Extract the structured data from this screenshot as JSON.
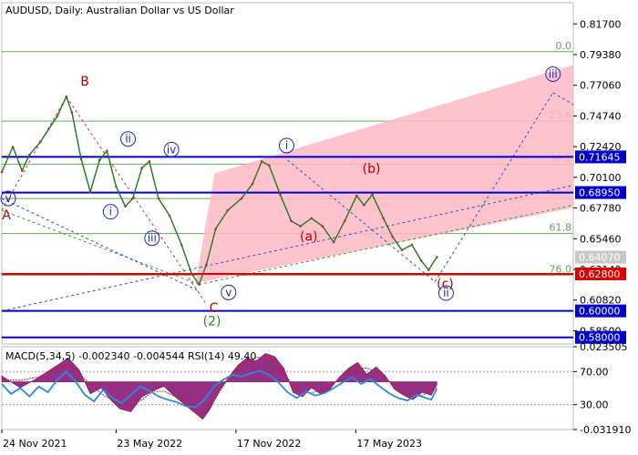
{
  "chart_data": {
    "type": "line",
    "header": "AUDUSD, Daily:  Australian Dollar vs US Dollar",
    "x_ticks": [
      "24 Nov 2021",
      "23 May 2022",
      "17 Nov 2022",
      "17 May 2023"
    ],
    "y_ticks": [
      "0.81700",
      "0.79380",
      "0.77060",
      "0.74740",
      "0.72420",
      "0.70100",
      "0.67780",
      "0.65460",
      "0.63140",
      "0.60820",
      "0.58500"
    ],
    "ylim": [
      0.575,
      0.833
    ],
    "price_path": [
      {
        "t": 0,
        "v": 0.705
      },
      {
        "t": 12,
        "v": 0.724
      },
      {
        "t": 22,
        "v": 0.706
      },
      {
        "t": 30,
        "v": 0.718
      },
      {
        "t": 42,
        "v": 0.728
      },
      {
        "t": 60,
        "v": 0.747
      },
      {
        "t": 70,
        "v": 0.762
      },
      {
        "t": 76,
        "v": 0.75
      },
      {
        "t": 86,
        "v": 0.715
      },
      {
        "t": 96,
        "v": 0.69
      },
      {
        "t": 106,
        "v": 0.714
      },
      {
        "t": 114,
        "v": 0.721
      },
      {
        "t": 124,
        "v": 0.694
      },
      {
        "t": 134,
        "v": 0.679
      },
      {
        "t": 142,
        "v": 0.685
      },
      {
        "t": 152,
        "v": 0.708
      },
      {
        "t": 160,
        "v": 0.713
      },
      {
        "t": 170,
        "v": 0.685
      },
      {
        "t": 182,
        "v": 0.672
      },
      {
        "t": 195,
        "v": 0.65
      },
      {
        "t": 206,
        "v": 0.628
      },
      {
        "t": 214,
        "v": 0.62
      },
      {
        "t": 222,
        "v": 0.635
      },
      {
        "t": 232,
        "v": 0.662
      },
      {
        "t": 245,
        "v": 0.676
      },
      {
        "t": 260,
        "v": 0.685
      },
      {
        "t": 272,
        "v": 0.696
      },
      {
        "t": 282,
        "v": 0.713
      },
      {
        "t": 290,
        "v": 0.71
      },
      {
        "t": 302,
        "v": 0.688
      },
      {
        "t": 314,
        "v": 0.668
      },
      {
        "t": 324,
        "v": 0.664
      },
      {
        "t": 336,
        "v": 0.67
      },
      {
        "t": 348,
        "v": 0.664
      },
      {
        "t": 360,
        "v": 0.652
      },
      {
        "t": 372,
        "v": 0.668
      },
      {
        "t": 385,
        "v": 0.687
      },
      {
        "t": 393,
        "v": 0.68
      },
      {
        "t": 402,
        "v": 0.688
      },
      {
        "t": 414,
        "v": 0.67
      },
      {
        "t": 424,
        "v": 0.656
      },
      {
        "t": 434,
        "v": 0.646
      },
      {
        "t": 445,
        "v": 0.65
      },
      {
        "t": 455,
        "v": 0.638
      },
      {
        "t": 463,
        "v": 0.631
      },
      {
        "t": 472,
        "v": 0.6407
      }
    ],
    "t_max": 620,
    "horizontal_levels": [
      {
        "label": "0.71645",
        "value": 0.71645,
        "color": "#0000cc"
      },
      {
        "label": "0.68950",
        "value": 0.6895,
        "color": "#0000cc"
      },
      {
        "label": "0.62800",
        "value": 0.628,
        "color": "#dd0000"
      },
      {
        "label": "0.60000",
        "value": 0.6,
        "color": "#0000cc"
      },
      {
        "label": "0.58000",
        "value": 0.58,
        "color": "#0000cc"
      }
    ],
    "current_price": {
      "label": "0.64070",
      "value": 0.6407
    },
    "fib_levels": [
      {
        "label": "0.0",
        "value": 0.796
      },
      {
        "label": "23.6",
        "value": 0.7435
      },
      {
        "label": "38.2",
        "value": 0.711
      },
      {
        "label": "50.0",
        "value": 0.685
      },
      {
        "label": "61.8",
        "value": 0.6585
      },
      {
        "label": "76.0",
        "value": 0.627
      }
    ],
    "channel": {
      "upper": [
        {
          "t": 231,
          "v": 0.704
        },
        {
          "t": 620,
          "v": 0.786
        }
      ],
      "lower": [
        {
          "t": 210,
          "v": 0.621
        },
        {
          "t": 620,
          "v": 0.678
        }
      ]
    },
    "wave_labels": [
      {
        "text": "B",
        "t": 90,
        "v": 0.773,
        "color": "#c00000",
        "circled": false
      },
      {
        "text": "A",
        "t": 5,
        "v": 0.672,
        "color": "#c00000",
        "circled": false
      },
      {
        "text": "C",
        "t": 230,
        "v": 0.602,
        "color": "#c00000",
        "circled": false
      },
      {
        "text": "(2)",
        "t": 228,
        "v": 0.592,
        "color": "#2a8a2a",
        "circled": false
      },
      {
        "text": "(a)",
        "t": 333,
        "v": 0.656,
        "color": "#c00000",
        "circled": false
      },
      {
        "text": "(b)",
        "t": 401,
        "v": 0.707,
        "color": "#c00000",
        "circled": false
      },
      {
        "text": "(c)",
        "t": 481,
        "v": 0.62,
        "color": "#c00000",
        "circled": false
      },
      {
        "text": "v",
        "t": 7,
        "v": 0.685,
        "color": "#1a2ab0",
        "circled": true
      },
      {
        "text": "i",
        "t": 118,
        "v": 0.675,
        "color": "#1a2ab0",
        "circled": true
      },
      {
        "text": "ii",
        "t": 137,
        "v": 0.73,
        "color": "#1a2ab0",
        "circled": true
      },
      {
        "text": "iii",
        "t": 163,
        "v": 0.655,
        "color": "#1a2ab0",
        "circled": true
      },
      {
        "text": "iv",
        "t": 184,
        "v": 0.722,
        "color": "#1a2ab0",
        "circled": true
      },
      {
        "text": "v",
        "t": 246,
        "v": 0.614,
        "color": "#1a2ab0",
        "circled": true
      },
      {
        "text": "i",
        "t": 309,
        "v": 0.725,
        "color": "#1a2ab0",
        "circled": true
      },
      {
        "text": "ii",
        "t": 482,
        "v": 0.6135,
        "color": "#1a2ab0",
        "circled": true
      },
      {
        "text": "iii",
        "t": 598,
        "v": 0.779,
        "color": "#1a2ab0",
        "circled": true
      }
    ],
    "indicator": {
      "header": "MACD(5,34,5) -0.002340 -0.004544 RSI(14) 49.40",
      "y_ticks": [
        "0.023505",
        "70.00",
        "30.00",
        "-0.031910"
      ],
      "macd_histogram": [
        {
          "t": 0,
          "v": 0.004
        },
        {
          "t": 20,
          "v": -0.004
        },
        {
          "t": 40,
          "v": 0.003
        },
        {
          "t": 60,
          "v": 0.011
        },
        {
          "t": 72,
          "v": 0.016
        },
        {
          "t": 84,
          "v": 0.008
        },
        {
          "t": 96,
          "v": -0.008
        },
        {
          "t": 108,
          "v": -0.004
        },
        {
          "t": 118,
          "v": -0.012
        },
        {
          "t": 128,
          "v": -0.018
        },
        {
          "t": 140,
          "v": -0.02
        },
        {
          "t": 152,
          "v": -0.01
        },
        {
          "t": 164,
          "v": -0.006
        },
        {
          "t": 176,
          "v": -0.003
        },
        {
          "t": 188,
          "v": -0.01
        },
        {
          "t": 200,
          "v": -0.016
        },
        {
          "t": 210,
          "v": -0.021
        },
        {
          "t": 218,
          "v": -0.025
        },
        {
          "t": 226,
          "v": -0.018
        },
        {
          "t": 236,
          "v": -0.006
        },
        {
          "t": 246,
          "v": 0.003
        },
        {
          "t": 256,
          "v": 0.011
        },
        {
          "t": 266,
          "v": 0.016
        },
        {
          "t": 276,
          "v": 0.014
        },
        {
          "t": 286,
          "v": 0.019
        },
        {
          "t": 296,
          "v": 0.017
        },
        {
          "t": 306,
          "v": 0.009
        },
        {
          "t": 316,
          "v": -0.007
        },
        {
          "t": 326,
          "v": -0.01
        },
        {
          "t": 336,
          "v": -0.004
        },
        {
          "t": 346,
          "v": -0.008
        },
        {
          "t": 356,
          "v": -0.005
        },
        {
          "t": 366,
          "v": 0.003
        },
        {
          "t": 376,
          "v": 0.009
        },
        {
          "t": 386,
          "v": 0.013
        },
        {
          "t": 396,
          "v": 0.005
        },
        {
          "t": 406,
          "v": 0.01
        },
        {
          "t": 416,
          "v": 0.004
        },
        {
          "t": 426,
          "v": -0.005
        },
        {
          "t": 436,
          "v": -0.009
        },
        {
          "t": 446,
          "v": -0.012
        },
        {
          "t": 456,
          "v": -0.007
        },
        {
          "t": 466,
          "v": -0.009
        },
        {
          "t": 472,
          "v": -0.002
        }
      ],
      "rsi": [
        {
          "t": 0,
          "v": 55
        },
        {
          "t": 10,
          "v": 43
        },
        {
          "t": 20,
          "v": 50
        },
        {
          "t": 30,
          "v": 40
        },
        {
          "t": 40,
          "v": 52
        },
        {
          "t": 50,
          "v": 45
        },
        {
          "t": 60,
          "v": 60
        },
        {
          "t": 70,
          "v": 70
        },
        {
          "t": 80,
          "v": 58
        },
        {
          "t": 90,
          "v": 42
        },
        {
          "t": 100,
          "v": 34
        },
        {
          "t": 110,
          "v": 48
        },
        {
          "t": 120,
          "v": 38
        },
        {
          "t": 130,
          "v": 32
        },
        {
          "t": 140,
          "v": 42
        },
        {
          "t": 150,
          "v": 52
        },
        {
          "t": 160,
          "v": 47
        },
        {
          "t": 170,
          "v": 40
        },
        {
          "t": 180,
          "v": 36
        },
        {
          "t": 190,
          "v": 33
        },
        {
          "t": 200,
          "v": 28
        },
        {
          "t": 210,
          "v": 27
        },
        {
          "t": 220,
          "v": 36
        },
        {
          "t": 230,
          "v": 52
        },
        {
          "t": 240,
          "v": 60
        },
        {
          "t": 250,
          "v": 66
        },
        {
          "t": 260,
          "v": 64
        },
        {
          "t": 270,
          "v": 68
        },
        {
          "t": 280,
          "v": 71
        },
        {
          "t": 290,
          "v": 66
        },
        {
          "t": 300,
          "v": 57
        },
        {
          "t": 310,
          "v": 45
        },
        {
          "t": 320,
          "v": 38
        },
        {
          "t": 330,
          "v": 46
        },
        {
          "t": 340,
          "v": 41
        },
        {
          "t": 350,
          "v": 44
        },
        {
          "t": 360,
          "v": 50
        },
        {
          "t": 370,
          "v": 57
        },
        {
          "t": 380,
          "v": 63
        },
        {
          "t": 390,
          "v": 55
        },
        {
          "t": 400,
          "v": 61
        },
        {
          "t": 410,
          "v": 52
        },
        {
          "t": 420,
          "v": 44
        },
        {
          "t": 430,
          "v": 38
        },
        {
          "t": 440,
          "v": 35
        },
        {
          "t": 450,
          "v": 42
        },
        {
          "t": 460,
          "v": 38
        },
        {
          "t": 466,
          "v": 36
        },
        {
          "t": 472,
          "v": 49
        }
      ],
      "macd_range": [
        -0.0319,
        0.0235
      ],
      "rsi_range": [
        0,
        100
      ]
    }
  }
}
